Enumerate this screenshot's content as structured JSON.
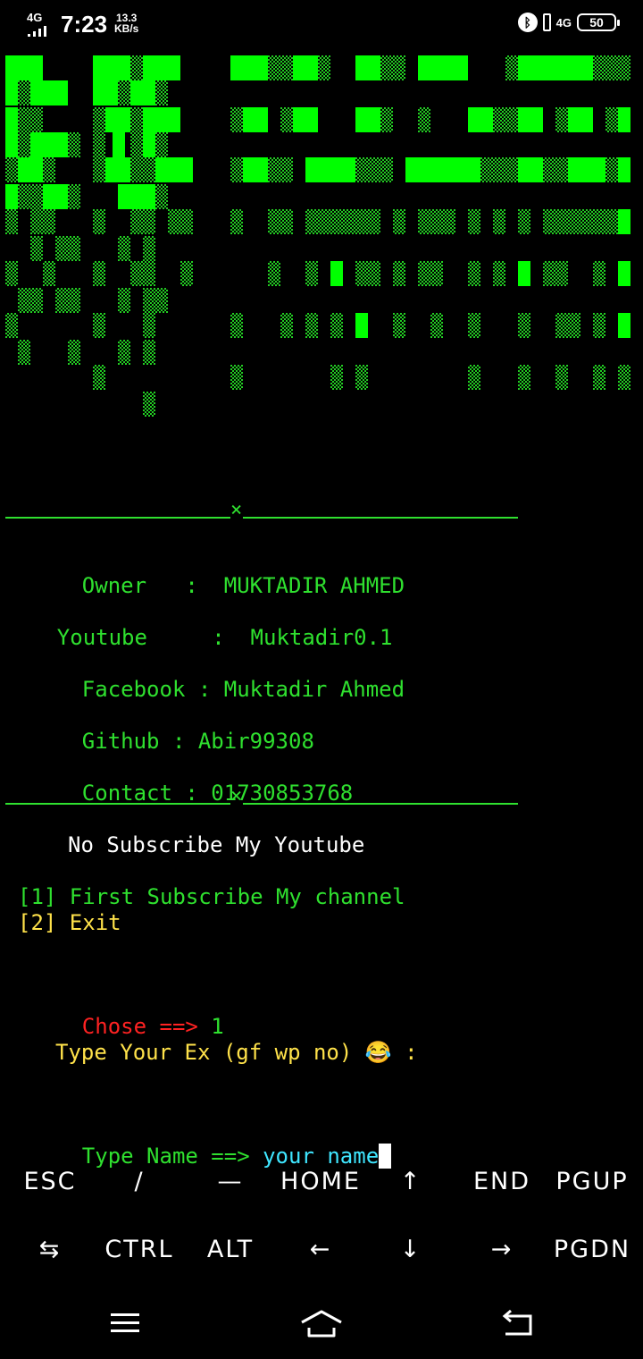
{
  "status_bar": {
    "network": "4G",
    "time": "7:23",
    "speed_value": "13.3",
    "speed_unit": "KB/s",
    "network_right": "4G",
    "battery": "50"
  },
  "colors": {
    "terminal_green": "#2fe02f",
    "banner_green": "#00ff00",
    "yellow": "#ffe24a",
    "red": "#ff2222",
    "cyan": "#3fe6ff"
  },
  "separator_mark": "×",
  "info": {
    "owner_label": "Owner   :  ",
    "owner_value": "MUKTADIR AHMED",
    "youtube_label": "Youtube     :  ",
    "youtube_value": "Muktadir0.1",
    "facebook_label": "Facebook : ",
    "facebook_value": "Muktadir Ahmed",
    "github_label": "Github : ",
    "github_value": "Abir99308",
    "contact_label": "Contact : ",
    "contact_value": "01730853768"
  },
  "menu": {
    "notice": "No Subscribe My Youtube",
    "option1": "[1] First Subscribe My channel",
    "option2": "[2] Exit"
  },
  "prompt": {
    "chose_label": "Chose ==> ",
    "chose_value": "1",
    "ex_prompt": "Type Your Ex (gf wp no) 😂 :",
    "name_label": "Type Name ==> ",
    "name_value": "your name"
  },
  "extra_keys": {
    "row1": [
      "ESC",
      "/",
      "—",
      "HOME",
      "↑",
      "END",
      "PGUP"
    ],
    "row2": [
      "⇆",
      "CTRL",
      "ALT",
      "←",
      "↓",
      "→",
      "PGDN"
    ]
  },
  "navbar": {
    "icons": [
      "menu-icon",
      "home-icon",
      "back-icon"
    ]
  }
}
